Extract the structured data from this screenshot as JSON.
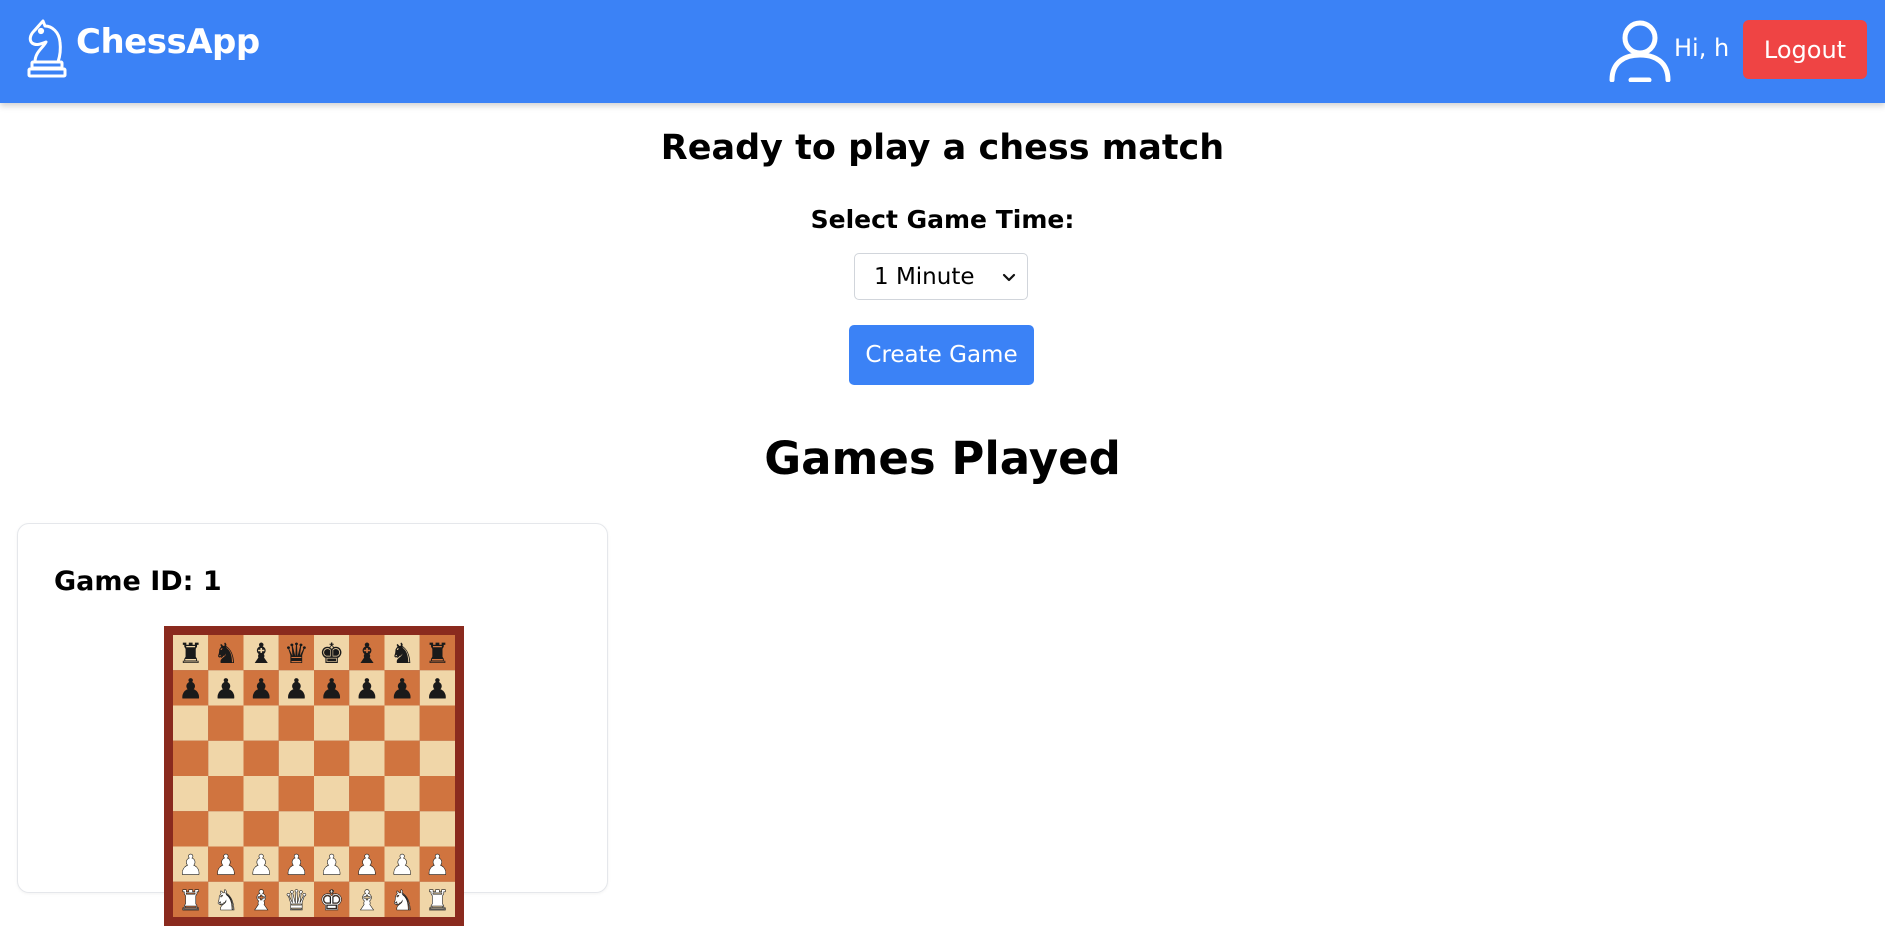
{
  "navbar": {
    "brand_name": "ChessApp",
    "brand_icon": "knight-icon",
    "user_icon": "user-icon",
    "greeting": "Hi, h",
    "logout_label": "Logout"
  },
  "main": {
    "heading": "Ready to play a chess match",
    "time_label": "Select Game Time:",
    "time_select": {
      "selected": "1 Minute",
      "icon": "chevron-down-icon"
    },
    "create_label": "Create Game"
  },
  "games": {
    "heading": "Games Played",
    "cards": [
      {
        "id_label": "Game ID: 1",
        "board": {
          "position": [
            [
              "r",
              "n",
              "b",
              "q",
              "k",
              "b",
              "n",
              "r"
            ],
            [
              "p",
              "p",
              "p",
              "p",
              "p",
              "p",
              "p",
              "p"
            ],
            [
              "",
              "",
              "",
              "",
              "",
              "",
              "",
              ""
            ],
            [
              "",
              "",
              "",
              "",
              "",
              "",
              "",
              ""
            ],
            [
              "",
              "",
              "",
              "",
              "",
              "",
              "",
              ""
            ],
            [
              "",
              "",
              "",
              "",
              "",
              "",
              "",
              ""
            ],
            [
              "P",
              "P",
              "P",
              "P",
              "P",
              "P",
              "P",
              "P"
            ],
            [
              "R",
              "N",
              "B",
              "Q",
              "K",
              "B",
              "N",
              "R"
            ]
          ]
        }
      }
    ]
  },
  "colors": {
    "primary": "#3b82f6",
    "danger": "#ef4444",
    "board_light": "#f0d6a8",
    "board_dark": "#d0743f",
    "board_frame": "#8a2a1e"
  }
}
